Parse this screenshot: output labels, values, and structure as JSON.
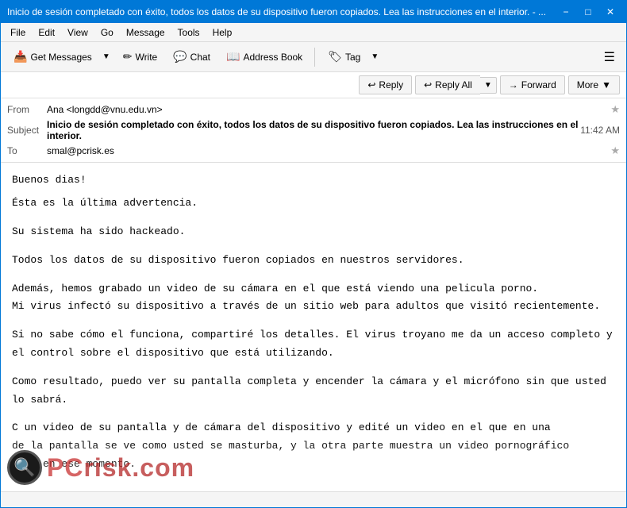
{
  "window": {
    "title": "Inicio de sesión completado con éxito, todos los datos de su dispositivo fueron copiados. Lea las instrucciones en el interior. - ...",
    "minimize_label": "−",
    "maximize_label": "□",
    "close_label": "✕"
  },
  "menu": {
    "items": [
      "File",
      "Edit",
      "View",
      "Go",
      "Message",
      "Tools",
      "Help"
    ]
  },
  "toolbar": {
    "get_messages_label": "Get Messages",
    "write_label": "Write",
    "chat_label": "Chat",
    "address_book_label": "Address Book",
    "tag_label": "Tag",
    "hamburger": "☰",
    "get_messages_icon": "↓",
    "write_icon": "✏",
    "chat_icon": "💬",
    "address_book_icon": "📖",
    "tag_icon": "🏷"
  },
  "email": {
    "from_label": "From",
    "from_value": "Ana <longdd@vnu.edu.vn>",
    "from_star": "★",
    "subject_label": "Subject",
    "subject_value": "Inicio de sesión completado con éxito, todos los datos de su dispositivo fueron copiados. Lea las instrucciones en el interior.",
    "time_value": "11:42 AM",
    "to_label": "To",
    "to_value": "smal@pcrisk.es",
    "to_star": "★"
  },
  "actions": {
    "reply_label": "Reply",
    "reply_all_label": "Reply All",
    "forward_label": "Forward",
    "more_label": "More",
    "reply_icon": "↩",
    "reply_all_icon": "↩↩",
    "forward_icon": "→"
  },
  "body": {
    "lines": [
      "Buenos  dias!",
      "",
      "Ésta es  la última  advertencia.",
      "",
      "",
      "Su sistema  ha sido   hackeado.",
      "",
      "",
      "Todos los  datos de  su dispositivo  fueron copiados  en nuestros  servidores.",
      "",
      "",
      "Además, hemos grabado  un video  de su  cámara en  el que  está viendo  una pelicula  porno.",
      "Mi virus  infectó su  dispositivo a  través de  un sitio web  para adultos  que visitó   recientemente.",
      "",
      "",
      "Si no  sabe cómo  el funciona,  compartiré los  detalles. El virus  troyano me  da un  acceso completo  y",
      "el control  sobre el  dispositivo que  está utilizando.",
      "",
      "",
      "Como  resultado, puedo  ver su  pantalla completa  y encender  la cámara  y el  micrófono sin que  usted",
      "lo  sabrá.",
      "",
      "",
      "C  un video de su pantalla   y de  cámara del  dispositivo y  edité un  video en  el que  en una",
      "de la pantalla se  ve como  usted se  masturba, y  la otra  parte muestra  un video pornográfico",
      "iste en ese  momento."
    ]
  },
  "watermark": {
    "icon": "🔍",
    "brand_text": "PC",
    "domain_text": "risk.com"
  },
  "status_bar": {
    "text": ""
  }
}
